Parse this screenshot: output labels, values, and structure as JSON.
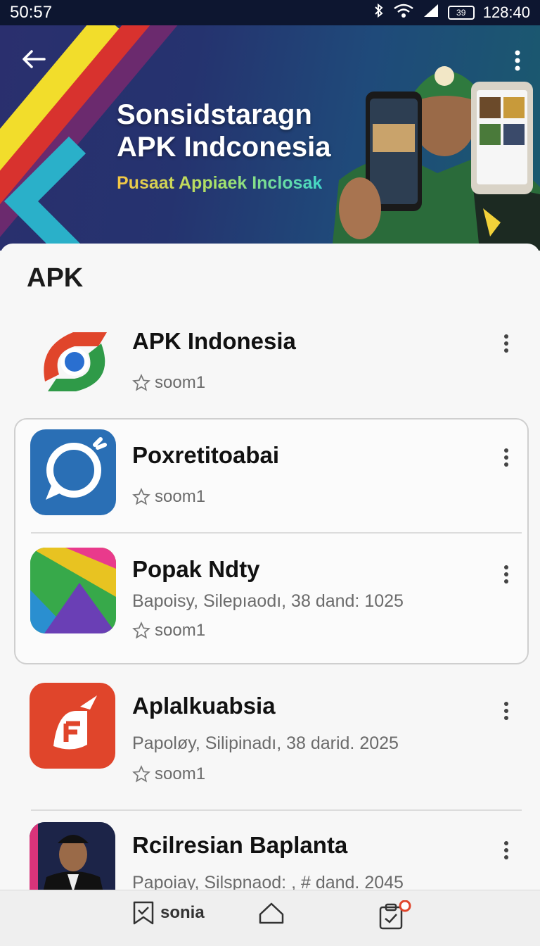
{
  "status_bar": {
    "time": "50:57",
    "battery": "39",
    "clock": "128:40"
  },
  "banner": {
    "title_line1": "Sonsidstaragn",
    "title_line2": "APK Indconesia",
    "subtitle": "Pusaat Appiaek Inclosak"
  },
  "section_title": "APK",
  "apps": [
    {
      "name": "APK Indonesia",
      "meta": "",
      "rating": "soom1"
    },
    {
      "name": "Poxretitoabai",
      "meta": "",
      "rating": "soom1"
    },
    {
      "name": "Popak Ndty",
      "meta": "Bapoisy, Silepıaodı, 38 dand: 1025",
      "rating": "soom1"
    },
    {
      "name": "Aplalkuabsia",
      "meta": "Papoløy, Silipinadı, 38 darid. 2025",
      "rating": "soom1"
    },
    {
      "name": "Rcilresian Baplanta",
      "meta": "Papoiay, Silspnaod: , # dand. 2045",
      "rating": ""
    }
  ],
  "bottom_nav": {
    "item1_label": "sonia"
  },
  "colors": {
    "status_bar": "#0d1630",
    "banner": "#25336f",
    "sheet": "#f7f7f7",
    "accent_red": "#e0452b",
    "blue_icon": "#2a6fb5"
  }
}
